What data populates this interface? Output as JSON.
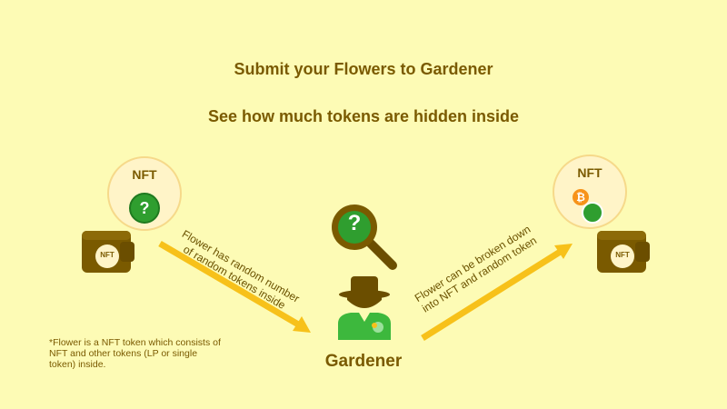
{
  "header": {
    "title": "Submit your Flowers to Gardener",
    "subtitle": "See how much tokens are hidden inside"
  },
  "left": {
    "nft_label": "NFT",
    "question": "?",
    "wallet_label": "NFT"
  },
  "arrows": {
    "left_text_line1": "Flower has random number",
    "left_text_line2": "of random tokens inside",
    "right_text_line1": "Flower can be broken down",
    "right_text_line2": "into NFT and random token"
  },
  "center": {
    "magnifier_question": "?",
    "gardener_label": "Gardener"
  },
  "right": {
    "nft_label": "NFT",
    "wallet_label": "NFT"
  },
  "footnote": {
    "text": "*Flower is a NFT token which consists of NFT and other tokens (LP or single token) inside."
  },
  "colors": {
    "background": "#fdfbb5",
    "title": "#7a5a00",
    "arrow": "#f7c11a",
    "wallet": "#7a5a00",
    "green": "#2f9e2f"
  }
}
